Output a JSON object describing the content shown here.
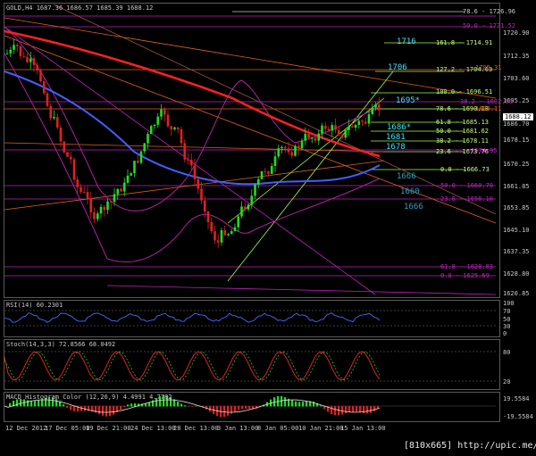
{
  "header": {
    "symbol_info": "GOLD,H4  1687.36 1686.57 1685.39 1688.12"
  },
  "price_axis": {
    "ticks": [
      "1720.90",
      "1712.35",
      "1703.60",
      "1695.25",
      "1686.70",
      "1678.15",
      "1670.25",
      "1661.85",
      "1653.85",
      "1645.10",
      "1637.35",
      "1628.80",
      "1620.85"
    ],
    "current_price": "1688.12"
  },
  "fib_upper": {
    "levels": [
      {
        "label": "78.6 - 1726.96",
        "color": "#c8c8c8"
      },
      {
        "label": "50.0 - 1721.52",
        "color": "#c020c0"
      },
      {
        "label": "161.8 - 1714.91",
        "color": "#a0ff40"
      },
      {
        "label": "127.2 - 1704.63",
        "color": "#a0ff40"
      },
      {
        "label": "1705.31",
        "color": "#e06020"
      },
      {
        "label": "100.0 - 1696.51",
        "color": "#a0ff40"
      },
      {
        "label": "38.2 - 1692.99",
        "color": "#c020c0"
      },
      {
        "label": "78.6 - 1690.18",
        "color": "#a0ff40"
      },
      {
        "label": "1690.11",
        "color": "#e06020"
      },
      {
        "label": "61.8 - 1685.13",
        "color": "#a0ff40"
      },
      {
        "label": "50.0 - 1681.62",
        "color": "#a0ff40"
      },
      {
        "label": "38.2 - 1678.11",
        "color": "#a0ff40"
      },
      {
        "label": "1674.95",
        "color": "#c020c0"
      },
      {
        "label": "23.6 - 1673.76",
        "color": "#a0ff40"
      },
      {
        "label": "0.0 - 1666.73",
        "color": "#a0ff40"
      },
      {
        "label": "50.0 - 1660.70",
        "color": "#c020c0"
      },
      {
        "label": "23.6 - 1656.10",
        "color": "#c020c0"
      },
      {
        "label": "61.8 - 1628.83",
        "color": "#c020c0"
      },
      {
        "label": "0.0 - 1625.69",
        "color": "#c020c0"
      }
    ],
    "markers": [
      {
        "text": "1716",
        "color": "#40e0ff"
      },
      {
        "text": "1706",
        "color": "#40e0ff"
      },
      {
        "text": "1695*",
        "color": "#40e0ff"
      },
      {
        "text": "1686*",
        "color": "#40e0ff"
      },
      {
        "text": "1681",
        "color": "#40e0ff"
      },
      {
        "text": "1678",
        "color": "#40e0ff"
      },
      {
        "text": "1666",
        "color": "#2aa0c0"
      },
      {
        "text": "1660",
        "color": "#2aa0c0"
      },
      {
        "text": "1666",
        "color": "#2aa0c0"
      }
    ]
  },
  "rsi": {
    "title": "RSI(14) 60.2301",
    "ticks": [
      "100",
      "70",
      "50",
      "30",
      "0"
    ]
  },
  "stoch": {
    "title": "Stoch(14,3,3) 72.8566 68.0492",
    "ticks": [
      "80",
      "20"
    ]
  },
  "macd": {
    "title": "MACD_Histogram_Color (12,26,9) 4.4991 4.7782",
    "ticks": [
      "19.5584",
      "-19.5584"
    ]
  },
  "x_axis": {
    "labels": [
      "12 Dec 2012",
      "17 Dec 05:00",
      "19 Dec 21:00",
      "24 Dec 13:00",
      "28 Dec 13:00",
      "3 Jan 13:00",
      "8 Jan 05:00",
      "10 Jan 21:00",
      "15 Jan 13:00"
    ]
  },
  "watermark": "[810x665] http://upic.me/",
  "colors": {
    "bull": "#22dd22",
    "bear": "#dd2222",
    "ma_red": "#ff2020",
    "ma_blue": "#4060ff",
    "bands": "#b020a0"
  }
}
